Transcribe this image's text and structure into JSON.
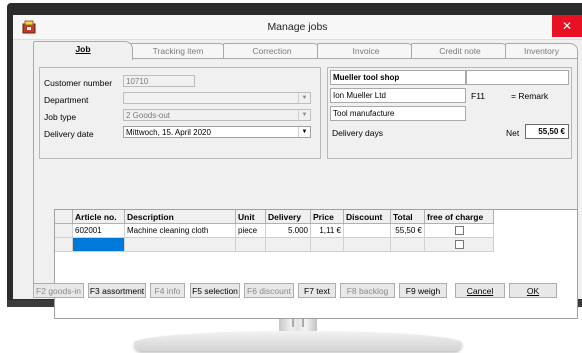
{
  "window": {
    "title": "Manage jobs",
    "close_glyph": "✕"
  },
  "tabs": [
    {
      "label": "Job",
      "active": true
    },
    {
      "label": "Tracking item"
    },
    {
      "label": "Correction"
    },
    {
      "label": "Invoice"
    },
    {
      "label": "Credit note"
    },
    {
      "label": "Inventory"
    }
  ],
  "form": {
    "customer_number_label": "Customer number",
    "customer_number_value": "10710",
    "department_label": "Department",
    "department_value": "",
    "job_type_label": "Job type",
    "job_type_value": "2  Goods-out",
    "delivery_date_label": "Delivery date",
    "delivery_date_value": "Mittwoch, 15. April 2020"
  },
  "customer": {
    "name": "Mueller tool shop",
    "contact": "Ion Mueller Ltd",
    "industry": "Tool manufacture",
    "code": "F11",
    "remark": "= Remark",
    "delivery_days_label": "Delivery days",
    "net_label": "Net",
    "net_value": "55,50 €"
  },
  "grid": {
    "columns": [
      "Article no.",
      "Description",
      "Unit",
      "Delivery",
      "Price",
      "Discount",
      "Total",
      "free of charge"
    ],
    "rows": [
      {
        "article": "602001",
        "description": "Machine cleaning cloth",
        "unit": "piece",
        "delivery": "5.000",
        "price": "1,11 €",
        "discount": "",
        "total": "55,50 €"
      }
    ]
  },
  "buttons": [
    {
      "label": "F2 goods-in",
      "enabled": false
    },
    {
      "label": "F3 assortment",
      "enabled": true
    },
    {
      "label": "F4 info",
      "enabled": false
    },
    {
      "label": "F5 selection",
      "enabled": true
    },
    {
      "label": "F6 discount",
      "enabled": false
    },
    {
      "label": "F7 text",
      "enabled": true
    },
    {
      "label": "F8 backlog",
      "enabled": false
    },
    {
      "label": "F9 weigh",
      "enabled": true
    },
    {
      "label": "Cancel",
      "enabled": true
    },
    {
      "label": "OK",
      "enabled": true
    }
  ],
  "colors": {
    "selection": "#0078d7",
    "close": "#e81123"
  }
}
